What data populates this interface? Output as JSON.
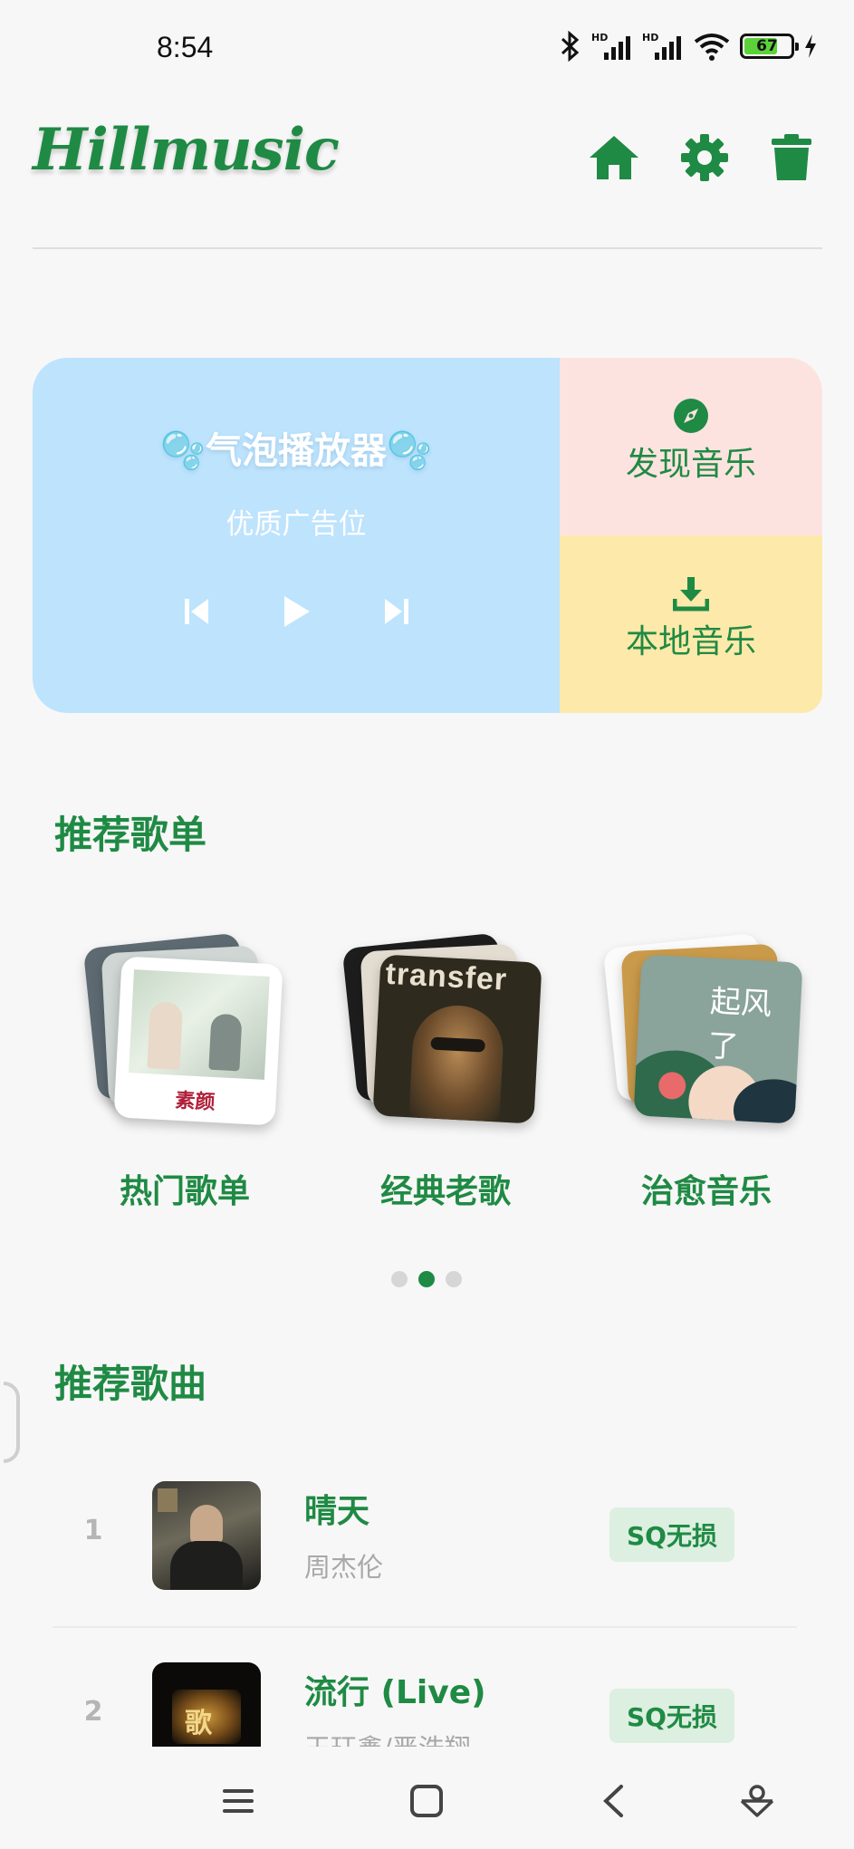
{
  "status_bar": {
    "time": "8:54",
    "battery": "67",
    "icons": [
      "bluetooth-icon",
      "signal-hd-icon",
      "signal-hd-icon",
      "wifi-icon",
      "battery-icon",
      "charging-icon"
    ]
  },
  "header": {
    "logo": "Hillmusic",
    "actions": [
      "home-icon",
      "settings-icon",
      "trash-icon"
    ]
  },
  "player": {
    "title": "🫧气泡播放器🫧",
    "subtitle": "优质广告位"
  },
  "tiles": {
    "discover": "发现音乐",
    "local": "本地音乐"
  },
  "playlists": {
    "section_title": "推荐歌单",
    "items": [
      {
        "label": "热门歌单",
        "cover_text": "素颜"
      },
      {
        "label": "经典老歌",
        "cover_text": "transfer"
      },
      {
        "label": "治愈音乐",
        "cover_text": "起风了"
      }
    ],
    "pager": {
      "count": 3,
      "active": 2
    }
  },
  "songs": {
    "section_title": "推荐歌曲",
    "items": [
      {
        "index": "1",
        "title": "晴天",
        "artist": "周杰伦",
        "badge": "SQ无损"
      },
      {
        "index": "2",
        "title": "流行 (Live)",
        "artist": "王珏鑫/严浩翔",
        "badge": "SQ无损"
      }
    ]
  },
  "colors": {
    "accent": "#1f8a44",
    "player_bg": "#bde3fd",
    "discover_bg": "#fde3e0",
    "local_bg": "#fde9a9",
    "badge_bg": "#dcefe0"
  }
}
